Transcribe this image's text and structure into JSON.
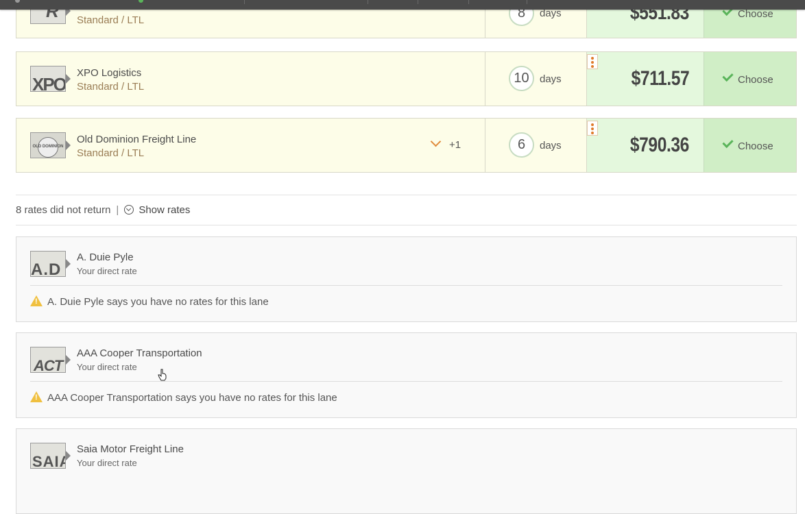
{
  "rates": [
    {
      "carrier": "",
      "service": "Standard / LTL",
      "days": "8",
      "days_label": "days",
      "price": "$551.83",
      "choose": "Choose",
      "logo_text": "R"
    },
    {
      "carrier": "XPO Logistics",
      "service": "Standard / LTL",
      "days": "10",
      "days_label": "days",
      "price": "$711.57",
      "choose": "Choose",
      "logo_text": "XPO"
    },
    {
      "carrier": "Old Dominion Freight Line",
      "service": "Standard / LTL",
      "days": "6",
      "days_label": "days",
      "price": "$790.36",
      "choose": "Choose",
      "logo_text": "OLD DOMINION",
      "expand": "+1"
    }
  ],
  "not_returned": {
    "text": "8 rates did not return",
    "separator": "|",
    "show_label": "Show rates"
  },
  "errors": [
    {
      "carrier": "A. Duie Pyle",
      "sub": "Your direct rate",
      "message": "A. Duie Pyle says you have no rates for this lane",
      "logo_text": "A.D"
    },
    {
      "carrier": "AAA Cooper Transportation",
      "sub": "Your direct rate",
      "message": "AAA Cooper Transportation says you have no rates for this lane",
      "logo_text": "ACT"
    },
    {
      "carrier": "Saia Motor Freight Line",
      "sub": "Your direct rate",
      "message": "",
      "logo_text": "SAIA"
    }
  ],
  "colors": {
    "accent_green": "#5ab45a",
    "price_bg": "#e4f8dd",
    "choose_bg": "#d0eec6",
    "warning": "#f0c040",
    "service_text": "#9a7d55"
  }
}
